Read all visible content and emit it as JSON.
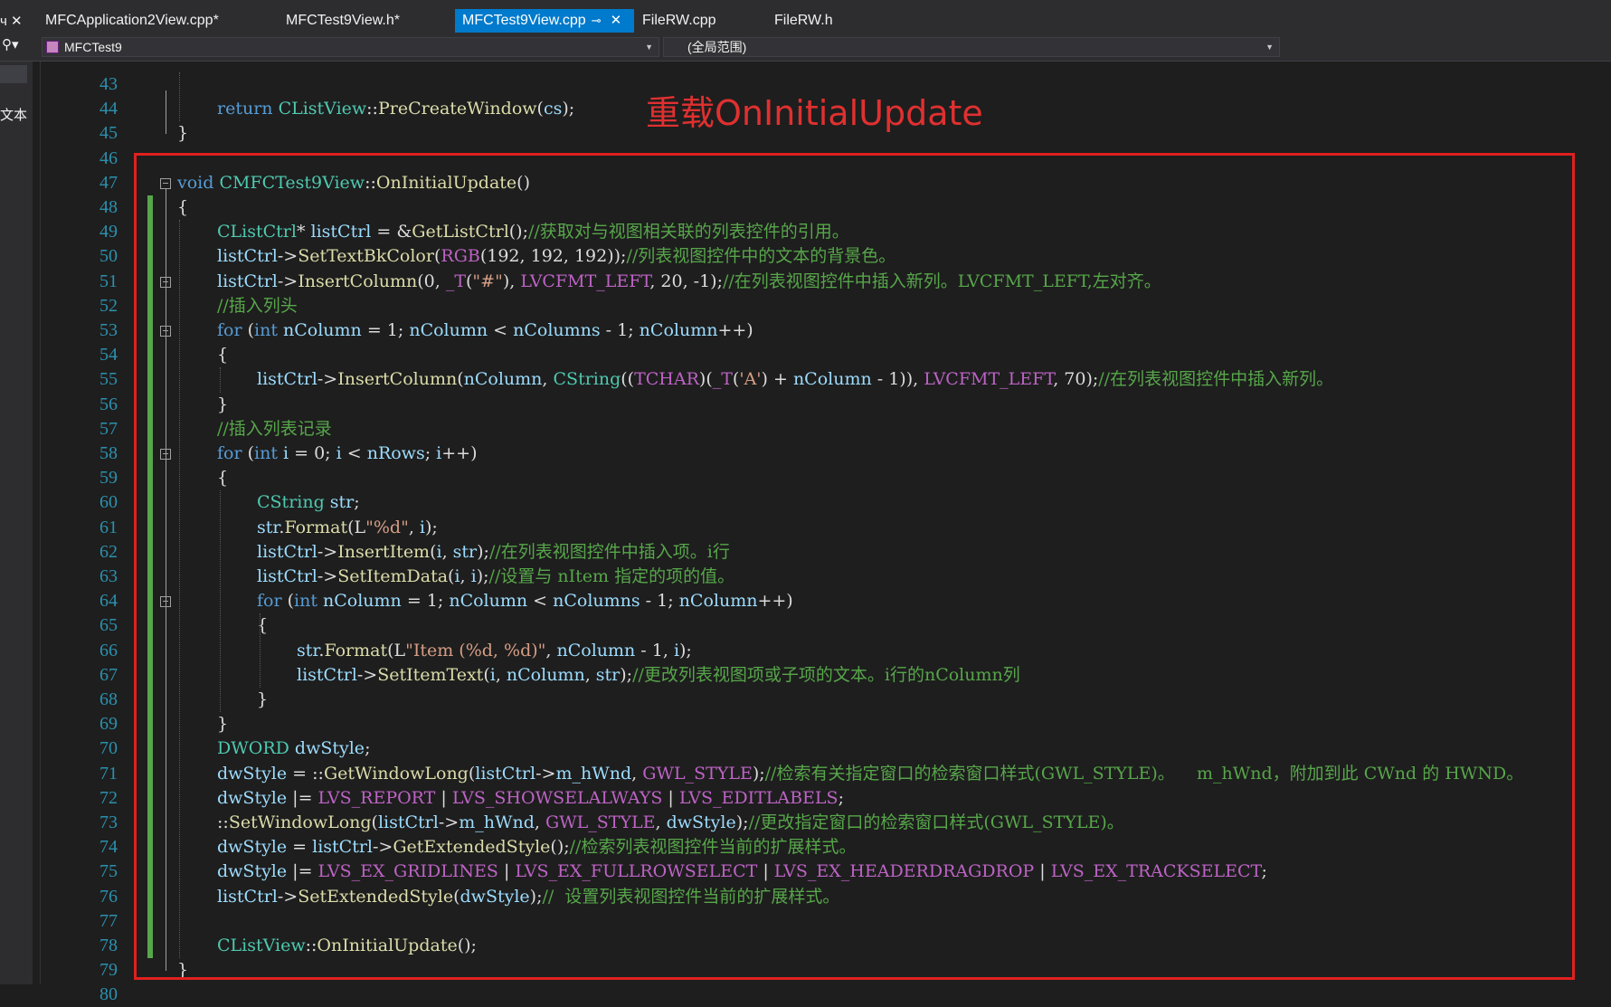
{
  "left_panel": {
    "pin_label": "ч",
    "close_glyph": "✕",
    "search_glyph": "⚲▾",
    "side_text": "文本"
  },
  "tabs": [
    {
      "label": "MFCApplication2View.cpp*",
      "active": false
    },
    {
      "label": "MFCTest9View.h*",
      "active": false
    },
    {
      "label": "MFCTest9View.cpp",
      "active": true,
      "pin_icon": "⊸",
      "close_icon": "✕"
    },
    {
      "label": "FileRW.cpp",
      "active": false
    },
    {
      "label": "FileRW.h",
      "active": false
    }
  ],
  "navbar": {
    "project": "MFCTest9",
    "scope": "(全局范围)"
  },
  "annotation": "重载OnInitialUpdate",
  "colors": {
    "accent": "#007acc",
    "highlight_box": "#e02020",
    "annotation": "#e03030"
  },
  "code_lines": [
    {
      "n": "43",
      "indent": 0,
      "tokens": []
    },
    {
      "n": "44",
      "indent": 1,
      "tokens": [
        [
          "kw",
          "return "
        ],
        [
          "type",
          "CListView"
        ],
        [
          "op",
          "::"
        ],
        [
          "fn",
          "PreCreateWindow"
        ],
        [
          "op",
          "("
        ],
        [
          "id",
          "cs"
        ],
        [
          "op",
          ");"
        ]
      ]
    },
    {
      "n": "45",
      "indent": 0,
      "tokens": [
        [
          "op",
          "}"
        ]
      ]
    },
    {
      "n": "46",
      "indent": 0,
      "tokens": []
    },
    {
      "n": "47",
      "indent": 0,
      "tokens": [
        [
          "kw",
          "void "
        ],
        [
          "type",
          "CMFCTest9View"
        ],
        [
          "op",
          "::"
        ],
        [
          "fn",
          "OnInitialUpdate"
        ],
        [
          "op",
          "()"
        ]
      ]
    },
    {
      "n": "48",
      "indent": 0,
      "tokens": [
        [
          "op",
          "{"
        ]
      ]
    },
    {
      "n": "49",
      "indent": 1,
      "tokens": [
        [
          "type",
          "CListCtrl"
        ],
        [
          "op",
          "* "
        ],
        [
          "id",
          "listCtrl"
        ],
        [
          "op",
          " = &"
        ],
        [
          "fn",
          "GetListCtrl"
        ],
        [
          "op",
          "();"
        ],
        [
          "cm",
          "//获取对与视图相关联的列表控件的引用。"
        ]
      ]
    },
    {
      "n": "50",
      "indent": 1,
      "tokens": [
        [
          "id",
          "listCtrl"
        ],
        [
          "op",
          "->"
        ],
        [
          "fn",
          "SetTextBkColor"
        ],
        [
          "op",
          "("
        ],
        [
          "mac",
          "RGB"
        ],
        [
          "op",
          "(192, 192, 192));"
        ],
        [
          "cm",
          "//列表视图控件中的文本的背景色。"
        ]
      ]
    },
    {
      "n": "51",
      "indent": 1,
      "tokens": [
        [
          "id",
          "listCtrl"
        ],
        [
          "op",
          "->"
        ],
        [
          "fn",
          "InsertColumn"
        ],
        [
          "op",
          "(0, "
        ],
        [
          "mac",
          "_T"
        ],
        [
          "op",
          "("
        ],
        [
          "str",
          "\"#\""
        ],
        [
          "op",
          "), "
        ],
        [
          "mac",
          "LVCFMT_LEFT"
        ],
        [
          "op",
          ", 20, -1);"
        ],
        [
          "cm",
          "//在列表视图控件中插入新列。LVCFMT_LEFT,左对齐。"
        ]
      ]
    },
    {
      "n": "52",
      "indent": 1,
      "tokens": [
        [
          "cm",
          "//插入列头"
        ]
      ]
    },
    {
      "n": "53",
      "indent": 1,
      "tokens": [
        [
          "kw",
          "for "
        ],
        [
          "op",
          "("
        ],
        [
          "kw",
          "int "
        ],
        [
          "id",
          "nColumn"
        ],
        [
          "op",
          " = 1; "
        ],
        [
          "id",
          "nColumn"
        ],
        [
          "op",
          " < "
        ],
        [
          "id",
          "nColumns"
        ],
        [
          "op",
          " - 1; "
        ],
        [
          "id",
          "nColumn"
        ],
        [
          "op",
          "++)"
        ]
      ]
    },
    {
      "n": "54",
      "indent": 1,
      "tokens": [
        [
          "op",
          "{"
        ]
      ]
    },
    {
      "n": "55",
      "indent": 2,
      "tokens": [
        [
          "id",
          "listCtrl"
        ],
        [
          "op",
          "->"
        ],
        [
          "fn",
          "InsertColumn"
        ],
        [
          "op",
          "("
        ],
        [
          "id",
          "nColumn"
        ],
        [
          "op",
          ", "
        ],
        [
          "type",
          "CString"
        ],
        [
          "op",
          "(("
        ],
        [
          "mac",
          "TCHAR"
        ],
        [
          "op",
          ")("
        ],
        [
          "mac",
          "_T"
        ],
        [
          "op",
          "("
        ],
        [
          "str",
          "'A'"
        ],
        [
          "op",
          ") + "
        ],
        [
          "id",
          "nColumn"
        ],
        [
          "op",
          " - 1)), "
        ],
        [
          "mac",
          "LVCFMT_LEFT"
        ],
        [
          "op",
          ", 70);"
        ],
        [
          "cm",
          "//在列表视图控件中插入新列。"
        ]
      ]
    },
    {
      "n": "56",
      "indent": 1,
      "tokens": [
        [
          "op",
          "}"
        ]
      ]
    },
    {
      "n": "57",
      "indent": 1,
      "tokens": [
        [
          "cm",
          "//插入列表记录"
        ]
      ]
    },
    {
      "n": "58",
      "indent": 1,
      "tokens": [
        [
          "kw",
          "for "
        ],
        [
          "op",
          "("
        ],
        [
          "kw",
          "int "
        ],
        [
          "id",
          "i"
        ],
        [
          "op",
          " = 0; "
        ],
        [
          "id",
          "i"
        ],
        [
          "op",
          " < "
        ],
        [
          "id",
          "nRows"
        ],
        [
          "op",
          "; "
        ],
        [
          "id",
          "i"
        ],
        [
          "op",
          "++)"
        ]
      ]
    },
    {
      "n": "59",
      "indent": 1,
      "tokens": [
        [
          "op",
          "{"
        ]
      ]
    },
    {
      "n": "60",
      "indent": 2,
      "tokens": [
        [
          "type",
          "CString "
        ],
        [
          "id",
          "str"
        ],
        [
          "op",
          ";"
        ]
      ]
    },
    {
      "n": "61",
      "indent": 2,
      "tokens": [
        [
          "id",
          "str"
        ],
        [
          "op",
          "."
        ],
        [
          "fn",
          "Format"
        ],
        [
          "op",
          "(L"
        ],
        [
          "str",
          "\"%d\""
        ],
        [
          "op",
          ", "
        ],
        [
          "id",
          "i"
        ],
        [
          "op",
          ");"
        ]
      ]
    },
    {
      "n": "62",
      "indent": 2,
      "tokens": [
        [
          "id",
          "listCtrl"
        ],
        [
          "op",
          "->"
        ],
        [
          "fn",
          "InsertItem"
        ],
        [
          "op",
          "("
        ],
        [
          "id",
          "i"
        ],
        [
          "op",
          ", "
        ],
        [
          "id",
          "str"
        ],
        [
          "op",
          ");"
        ],
        [
          "cm",
          "//在列表视图控件中插入项。i行"
        ]
      ]
    },
    {
      "n": "63",
      "indent": 2,
      "tokens": [
        [
          "id",
          "listCtrl"
        ],
        [
          "op",
          "->"
        ],
        [
          "fn",
          "SetItemData"
        ],
        [
          "op",
          "("
        ],
        [
          "id",
          "i"
        ],
        [
          "op",
          ", "
        ],
        [
          "id",
          "i"
        ],
        [
          "op",
          ");"
        ],
        [
          "cm",
          "//设置与 nItem 指定的项的值。"
        ]
      ]
    },
    {
      "n": "64",
      "indent": 2,
      "tokens": [
        [
          "kw",
          "for "
        ],
        [
          "op",
          "("
        ],
        [
          "kw",
          "int "
        ],
        [
          "id",
          "nColumn"
        ],
        [
          "op",
          " = 1; "
        ],
        [
          "id",
          "nColumn"
        ],
        [
          "op",
          " < "
        ],
        [
          "id",
          "nColumns"
        ],
        [
          "op",
          " - 1; "
        ],
        [
          "id",
          "nColumn"
        ],
        [
          "op",
          "++)"
        ]
      ]
    },
    {
      "n": "65",
      "indent": 2,
      "tokens": [
        [
          "op",
          "{"
        ]
      ]
    },
    {
      "n": "66",
      "indent": 3,
      "tokens": [
        [
          "id",
          "str"
        ],
        [
          "op",
          "."
        ],
        [
          "fn",
          "Format"
        ],
        [
          "op",
          "(L"
        ],
        [
          "str",
          "\"Item (%d, %d)\""
        ],
        [
          "op",
          ", "
        ],
        [
          "id",
          "nColumn"
        ],
        [
          "op",
          " - 1, "
        ],
        [
          "id",
          "i"
        ],
        [
          "op",
          ");"
        ]
      ]
    },
    {
      "n": "67",
      "indent": 3,
      "tokens": [
        [
          "id",
          "listCtrl"
        ],
        [
          "op",
          "->"
        ],
        [
          "fn",
          "SetItemText"
        ],
        [
          "op",
          "("
        ],
        [
          "id",
          "i"
        ],
        [
          "op",
          ", "
        ],
        [
          "id",
          "nColumn"
        ],
        [
          "op",
          ", "
        ],
        [
          "id",
          "str"
        ],
        [
          "op",
          ");"
        ],
        [
          "cm",
          "//更改列表视图项或子项的文本。i行的nColumn列"
        ]
      ]
    },
    {
      "n": "68",
      "indent": 2,
      "tokens": [
        [
          "op",
          "}"
        ]
      ]
    },
    {
      "n": "69",
      "indent": 1,
      "tokens": [
        [
          "op",
          "}"
        ]
      ]
    },
    {
      "n": "70",
      "indent": 1,
      "tokens": [
        [
          "type",
          "DWORD "
        ],
        [
          "id",
          "dwStyle"
        ],
        [
          "op",
          ";"
        ]
      ]
    },
    {
      "n": "71",
      "indent": 1,
      "tokens": [
        [
          "id",
          "dwStyle"
        ],
        [
          "op",
          " = ::"
        ],
        [
          "fn",
          "GetWindowLong"
        ],
        [
          "op",
          "("
        ],
        [
          "id",
          "listCtrl"
        ],
        [
          "op",
          "->"
        ],
        [
          "id",
          "m_hWnd"
        ],
        [
          "op",
          ", "
        ],
        [
          "mac",
          "GWL_STYLE"
        ],
        [
          "op",
          ");"
        ],
        [
          "cm",
          "//检索有关指定窗口的检索窗口样式(GWL_STYLE)。    m_hWnd，附加到此 CWnd 的 HWND。"
        ]
      ]
    },
    {
      "n": "72",
      "indent": 1,
      "tokens": [
        [
          "id",
          "dwStyle"
        ],
        [
          "op",
          " |= "
        ],
        [
          "mac",
          "LVS_REPORT"
        ],
        [
          "op",
          " | "
        ],
        [
          "mac",
          "LVS_SHOWSELALWAYS"
        ],
        [
          "op",
          " | "
        ],
        [
          "mac",
          "LVS_EDITLABELS"
        ],
        [
          "op",
          ";"
        ]
      ]
    },
    {
      "n": "73",
      "indent": 1,
      "tokens": [
        [
          "op",
          "::"
        ],
        [
          "fn",
          "SetWindowLong"
        ],
        [
          "op",
          "("
        ],
        [
          "id",
          "listCtrl"
        ],
        [
          "op",
          "->"
        ],
        [
          "id",
          "m_hWnd"
        ],
        [
          "op",
          ", "
        ],
        [
          "mac",
          "GWL_STYLE"
        ],
        [
          "op",
          ", "
        ],
        [
          "id",
          "dwStyle"
        ],
        [
          "op",
          ");"
        ],
        [
          "cm",
          "//更改指定窗口的检索窗口样式(GWL_STYLE)。"
        ]
      ]
    },
    {
      "n": "74",
      "indent": 1,
      "tokens": [
        [
          "id",
          "dwStyle"
        ],
        [
          "op",
          " = "
        ],
        [
          "id",
          "listCtrl"
        ],
        [
          "op",
          "->"
        ],
        [
          "fn",
          "GetExtendedStyle"
        ],
        [
          "op",
          "();"
        ],
        [
          "cm",
          "//检索列表视图控件当前的扩展样式。"
        ]
      ]
    },
    {
      "n": "75",
      "indent": 1,
      "tokens": [
        [
          "id",
          "dwStyle"
        ],
        [
          "op",
          " |= "
        ],
        [
          "mac",
          "LVS_EX_GRIDLINES"
        ],
        [
          "op",
          " | "
        ],
        [
          "mac",
          "LVS_EX_FULLROWSELECT"
        ],
        [
          "op",
          " | "
        ],
        [
          "mac",
          "LVS_EX_HEADERDRAGDROP"
        ],
        [
          "op",
          " | "
        ],
        [
          "mac",
          "LVS_EX_TRACKSELECT"
        ],
        [
          "op",
          ";"
        ]
      ]
    },
    {
      "n": "76",
      "indent": 1,
      "tokens": [
        [
          "id",
          "listCtrl"
        ],
        [
          "op",
          "->"
        ],
        [
          "fn",
          "SetExtendedStyle"
        ],
        [
          "op",
          "("
        ],
        [
          "id",
          "dwStyle"
        ],
        [
          "op",
          ");"
        ],
        [
          "cm",
          "//  设置列表视图控件当前的扩展样式。"
        ]
      ]
    },
    {
      "n": "77",
      "indent": 0,
      "tokens": []
    },
    {
      "n": "78",
      "indent": 1,
      "tokens": [
        [
          "type",
          "CListView"
        ],
        [
          "op",
          "::"
        ],
        [
          "fn",
          "OnInitialUpdate"
        ],
        [
          "op",
          "();"
        ]
      ]
    },
    {
      "n": "79",
      "indent": 0,
      "tokens": [
        [
          "op",
          "}"
        ]
      ]
    },
    {
      "n": "80",
      "indent": 0,
      "tokens": []
    }
  ],
  "fold_markers": [
    "47",
    "51",
    "53",
    "58",
    "64"
  ]
}
